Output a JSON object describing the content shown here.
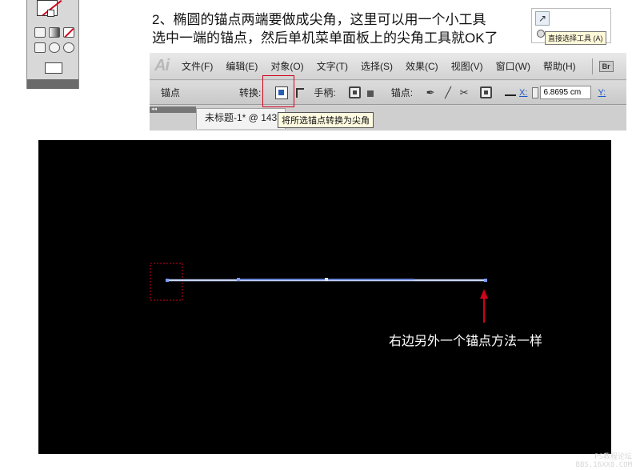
{
  "instruction": {
    "line1": "2、椭圆的锚点两端要做成尖角，这里可以用一个小工具",
    "line2": "选中一端的锚点，然后单机菜单面板上的尖角工具就OK了"
  },
  "tool_inset": {
    "tooltip": "直接选择工具 (A)",
    "icon": "direct-selection-arrow-icon"
  },
  "app": {
    "logo": "Ai",
    "menus": [
      "文件(F)",
      "编辑(E)",
      "对象(O)",
      "文字(T)",
      "选择(S)",
      "效果(C)",
      "视图(V)",
      "窗口(W)",
      "帮助(H)"
    ],
    "bridge_button": "Br"
  },
  "control_bar": {
    "anchor_label": "锚点",
    "convert_label": "转换:",
    "handles_label": "手柄:",
    "anchors_label": "锚点:",
    "x_label": "X:",
    "x_value": "6.8695 cm",
    "y_label": "Y:",
    "convert_tooltip": "将所选锚点转换为尖角"
  },
  "document": {
    "tab_title": "未标题-1* @ 143"
  },
  "canvas": {
    "annotation": "右边另外一个锚点方法一样",
    "colors": {
      "background": "#000000",
      "path": "#c8d4ff",
      "highlight": "#d0021b"
    }
  },
  "watermark": {
    "line1": "PS教程论坛",
    "line2": "BBS.16XX8.COM"
  }
}
